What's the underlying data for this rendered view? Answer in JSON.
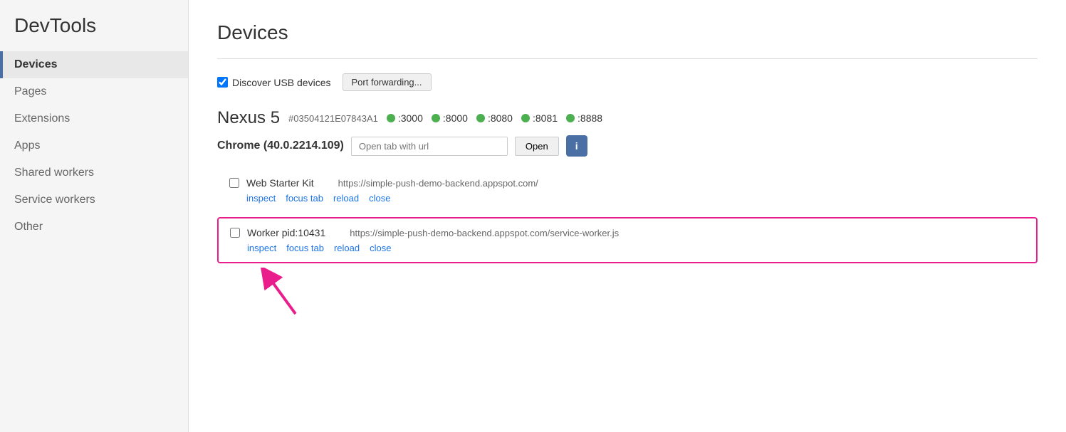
{
  "sidebar": {
    "app_title": "DevTools",
    "items": [
      {
        "id": "devices",
        "label": "Devices",
        "active": true
      },
      {
        "id": "pages",
        "label": "Pages",
        "active": false
      },
      {
        "id": "extensions",
        "label": "Extensions",
        "active": false
      },
      {
        "id": "apps",
        "label": "Apps",
        "active": false
      },
      {
        "id": "shared-workers",
        "label": "Shared workers",
        "active": false
      },
      {
        "id": "service-workers",
        "label": "Service workers",
        "active": false
      },
      {
        "id": "other",
        "label": "Other",
        "active": false
      }
    ]
  },
  "main": {
    "page_title": "Devices",
    "discover_usb_label": "Discover USB devices",
    "port_forwarding_btn": "Port forwarding...",
    "device": {
      "name": "Nexus 5",
      "id": "#03504121E07843A1",
      "ports": [
        ":3000",
        ":8000",
        ":8080",
        ":8081",
        ":8888"
      ]
    },
    "chrome": {
      "label": "Chrome (40.0.2214.109)",
      "url_placeholder": "Open tab with url",
      "open_btn": "Open",
      "info_icon": "i"
    },
    "tabs": [
      {
        "id": "web-starter-kit",
        "title": "Web Starter Kit",
        "url": "https://simple-push-demo-backend.appspot.com/",
        "actions": [
          "inspect",
          "focus tab",
          "reload",
          "close"
        ],
        "highlighted": false
      },
      {
        "id": "worker-pid",
        "title": "Worker pid:10431",
        "url": "https://simple-push-demo-backend.appspot.com/service-worker.js",
        "actions": [
          "inspect",
          "focus tab",
          "reload",
          "close"
        ],
        "highlighted": true
      }
    ]
  }
}
